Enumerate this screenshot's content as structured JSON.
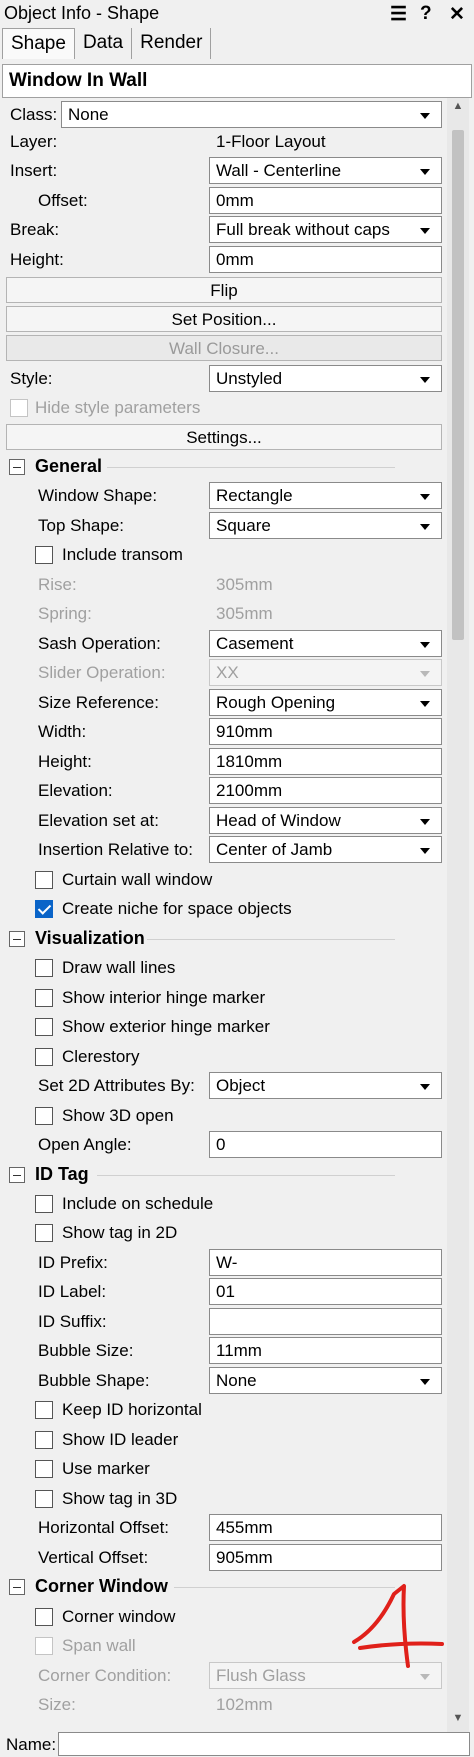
{
  "window_title": "Object Info - Shape",
  "title_icons": [
    "menu-icon",
    "help-icon",
    "close-icon"
  ],
  "title_icon_glyphs": [
    "☰",
    "?",
    "✕"
  ],
  "tabs": [
    "Shape",
    "Data",
    "Render"
  ],
  "header": "Window In Wall",
  "class": {
    "label": "Class:",
    "value": "None"
  },
  "layer": {
    "label": "Layer:",
    "value": "1-Floor Layout"
  },
  "insert": {
    "label": "Insert:",
    "value": "Wall - Centerline"
  },
  "offset": {
    "label": "Offset:",
    "value": "0mm"
  },
  "break": {
    "label": "Break:",
    "value": "Full break without caps"
  },
  "height_top": {
    "label": "Height:",
    "value": "0mm"
  },
  "buttons": {
    "flip": "Flip",
    "set_position": "Set Position...",
    "wall_closure": "Wall Closure...",
    "settings": "Settings..."
  },
  "style": {
    "label": "Style:",
    "value": "Unstyled"
  },
  "hide_style": "Hide style parameters",
  "general": {
    "title": "General",
    "window_shape": {
      "label": "Window Shape:",
      "value": "Rectangle"
    },
    "top_shape": {
      "label": "Top Shape:",
      "value": "Square"
    },
    "include_transom": "Include transom",
    "rise": {
      "label": "Rise:",
      "value": "305mm"
    },
    "spring": {
      "label": "Spring:",
      "value": "305mm"
    },
    "sash_operation": {
      "label": "Sash Operation:",
      "value": "Casement"
    },
    "slider_operation": {
      "label": "Slider Operation:",
      "value": "XX"
    },
    "size_reference": {
      "label": "Size Reference:",
      "value": "Rough Opening"
    },
    "width": {
      "label": "Width:",
      "value": "910mm"
    },
    "height": {
      "label": "Height:",
      "value": "1810mm"
    },
    "elevation": {
      "label": "Elevation:",
      "value": "2100mm"
    },
    "elevation_set_at": {
      "label": "Elevation set at:",
      "value": "Head of Window"
    },
    "insertion_relative": {
      "label": "Insertion Relative to:",
      "value": "Center of Jamb"
    },
    "curtain_wall": "Curtain wall window",
    "create_niche": "Create niche for space objects"
  },
  "visualization": {
    "title": "Visualization",
    "draw_wall_lines": "Draw wall lines",
    "interior_hinge": "Show interior hinge marker",
    "exterior_hinge": "Show exterior hinge marker",
    "clerestory": "Clerestory",
    "set_2d": {
      "label": "Set 2D Attributes By:",
      "value": "Object"
    },
    "show_3d_open": "Show 3D open",
    "open_angle": {
      "label": "Open Angle:",
      "value": "0"
    }
  },
  "id_tag": {
    "title": "ID Tag",
    "include_schedule": "Include on schedule",
    "show_tag_2d": "Show tag in 2D",
    "id_prefix": {
      "label": "ID Prefix:",
      "value": "W-"
    },
    "id_label": {
      "label": "ID Label:",
      "value": "01"
    },
    "id_suffix": {
      "label": "ID Suffix:",
      "value": ""
    },
    "bubble_size": {
      "label": "Bubble Size:",
      "value": "11mm"
    },
    "bubble_shape": {
      "label": "Bubble Shape:",
      "value": "None"
    },
    "keep_horizontal": "Keep ID horizontal",
    "show_leader": "Show ID leader",
    "use_marker": "Use marker",
    "show_tag_3d": "Show tag in 3D",
    "horizontal_offset": {
      "label": "Horizontal Offset:",
      "value": "455mm"
    },
    "vertical_offset": {
      "label": "Vertical Offset:",
      "value": "905mm"
    }
  },
  "corner_window": {
    "title": "Corner Window",
    "corner_window": "Corner window",
    "span_wall": "Span wall",
    "corner_condition": {
      "label": "Corner Condition:",
      "value": "Flush Glass"
    },
    "size": {
      "label": "Size:",
      "value": "102mm"
    }
  },
  "name_label": "Name:",
  "annotation_color": "#e0201a",
  "accent_color": "#0a64c8"
}
